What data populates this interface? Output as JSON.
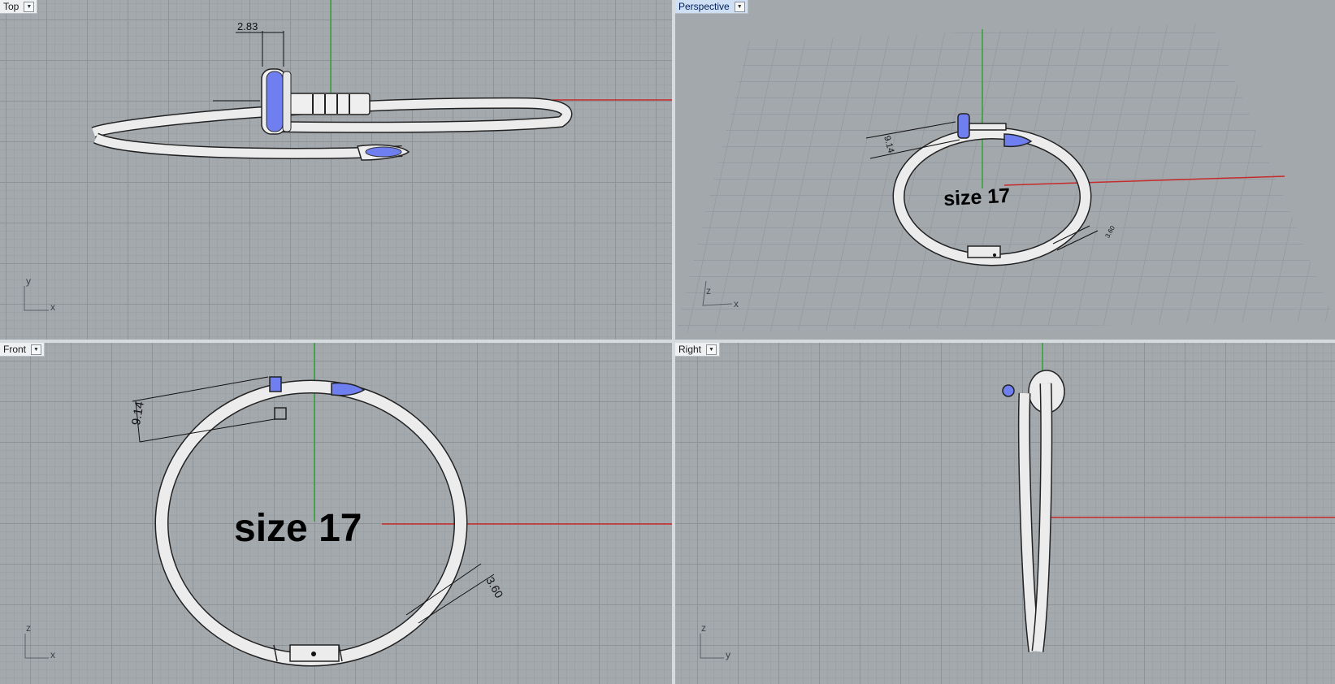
{
  "viewports": {
    "top": {
      "label": "Top",
      "dimension": "2.83",
      "axis_x": "x",
      "axis_y": "y"
    },
    "perspective": {
      "label": "Perspective",
      "dimension_a": "9.14",
      "dimension_b": "3.60",
      "size_label": "size 17",
      "axis_x": "x",
      "axis_z": "z"
    },
    "front": {
      "label": "Front",
      "dimension_a": "9.14",
      "dimension_b": "3.60",
      "size_label": "size 17",
      "axis_x": "x",
      "axis_z": "z"
    },
    "right": {
      "label": "Right",
      "axis_y": "y",
      "axis_z": "z"
    }
  },
  "colors": {
    "x_axis": "#c62b2b",
    "z_axis": "#2ea32e",
    "stones": "#6f7ff0",
    "metal": "#eeeeee",
    "active_tab": "#cfe0f5"
  },
  "icons": {
    "viewport_menu": "chevron-down-icon"
  }
}
